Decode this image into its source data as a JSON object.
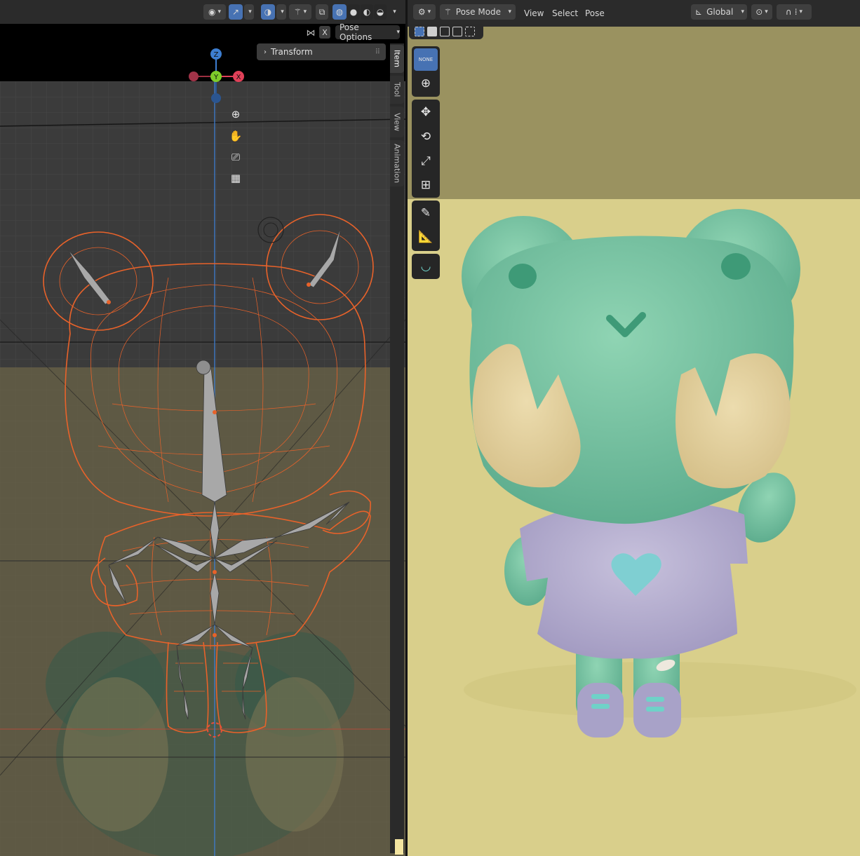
{
  "left_viewport": {
    "header": {
      "x_button_label": "X",
      "pose_options_label": "Pose Options"
    },
    "panel": {
      "transform_label": "Transform"
    },
    "sidebar_tabs": [
      "Item",
      "Tool",
      "View",
      "Animation"
    ],
    "gizmo": {
      "z_label": "Z",
      "y_label": "Y",
      "x_label": "X"
    }
  },
  "right_viewport": {
    "header": {
      "mode_label": "Pose Mode",
      "menus": [
        "View",
        "Select",
        "Pose"
      ],
      "orientation_label": "Global"
    },
    "toolbar": {
      "select_box_label": "NONE"
    }
  },
  "colors": {
    "accent": "#4772b3",
    "wireframe": "#e8622a",
    "frog_skin": "#79c7a6",
    "render_bg": "#d9cf8b",
    "shirt": "#b8b0d0"
  }
}
